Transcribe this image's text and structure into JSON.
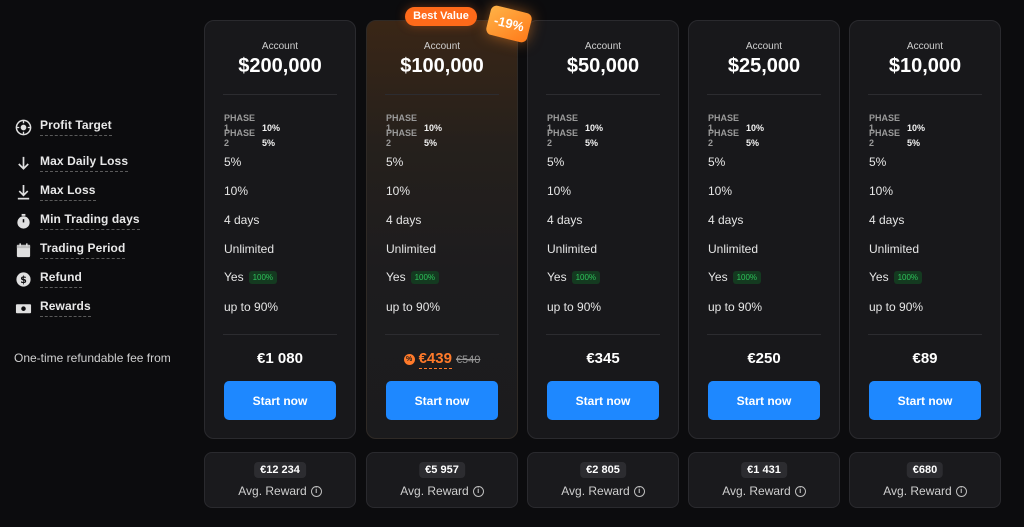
{
  "badges": {
    "best_value": "Best Value",
    "discount": "-19%"
  },
  "features": [
    {
      "icon": "target-icon",
      "label": "Profit Target"
    },
    {
      "icon": "arrow-down-icon",
      "label": "Max Daily Loss"
    },
    {
      "icon": "arrow-down-bar-icon",
      "label": "Max Loss"
    },
    {
      "icon": "stopwatch-icon",
      "label": "Min Trading days"
    },
    {
      "icon": "calendar-icon",
      "label": "Trading Period"
    },
    {
      "icon": "dollar-coin-icon",
      "label": "Refund"
    },
    {
      "icon": "banknote-icon",
      "label": "Rewards"
    }
  ],
  "fee_label": "One-time refundable fee from",
  "plans": [
    {
      "account_label": "Account",
      "amount": "$200,000",
      "phase1_label": "PHASE 1",
      "phase1_value": "10%",
      "phase2_label": "PHASE 2",
      "phase2_value": "5%",
      "max_daily_loss": "5%",
      "max_loss": "10%",
      "min_days": "4 days",
      "period": "Unlimited",
      "refund": "Yes",
      "refund_pct": "100%",
      "rewards": "up to 90%",
      "price": "€1 080",
      "cta": "Start now",
      "avg_reward_value": "€12 234",
      "avg_reward_label": "Avg. Reward"
    },
    {
      "account_label": "Account",
      "amount": "$100,000",
      "phase1_label": "PHASE 1",
      "phase1_value": "10%",
      "phase2_label": "PHASE 2",
      "phase2_value": "5%",
      "max_daily_loss": "5%",
      "max_loss": "10%",
      "min_days": "4 days",
      "period": "Unlimited",
      "refund": "Yes",
      "refund_pct": "100%",
      "rewards": "up to 90%",
      "price": "€439",
      "old_price": "€540",
      "cta": "Start now",
      "avg_reward_value": "€5 957",
      "avg_reward_label": "Avg. Reward"
    },
    {
      "account_label": "Account",
      "amount": "$50,000",
      "phase1_label": "PHASE 1",
      "phase1_value": "10%",
      "phase2_label": "PHASE 2",
      "phase2_value": "5%",
      "max_daily_loss": "5%",
      "max_loss": "10%",
      "min_days": "4 days",
      "period": "Unlimited",
      "refund": "Yes",
      "refund_pct": "100%",
      "rewards": "up to 90%",
      "price": "€345",
      "cta": "Start now",
      "avg_reward_value": "€2 805",
      "avg_reward_label": "Avg. Reward"
    },
    {
      "account_label": "Account",
      "amount": "$25,000",
      "phase1_label": "PHASE 1",
      "phase1_value": "10%",
      "phase2_label": "PHASE 2",
      "phase2_value": "5%",
      "max_daily_loss": "5%",
      "max_loss": "10%",
      "min_days": "4 days",
      "period": "Unlimited",
      "refund": "Yes",
      "refund_pct": "100%",
      "rewards": "up to 90%",
      "price": "€250",
      "cta": "Start now",
      "avg_reward_value": "€1 431",
      "avg_reward_label": "Avg. Reward"
    },
    {
      "account_label": "Account",
      "amount": "$10,000",
      "phase1_label": "PHASE 1",
      "phase1_value": "10%",
      "phase2_label": "PHASE 2",
      "phase2_value": "5%",
      "max_daily_loss": "5%",
      "max_loss": "10%",
      "min_days": "4 days",
      "period": "Unlimited",
      "refund": "Yes",
      "refund_pct": "100%",
      "rewards": "up to 90%",
      "price": "€89",
      "cta": "Start now",
      "avg_reward_value": "€680",
      "avg_reward_label": "Avg. Reward"
    }
  ],
  "colors": {
    "accent_blue": "#1e88ff",
    "accent_orange": "#ff7a2a",
    "badge_green": "#2ec25a",
    "background": "#0c0c0e"
  }
}
